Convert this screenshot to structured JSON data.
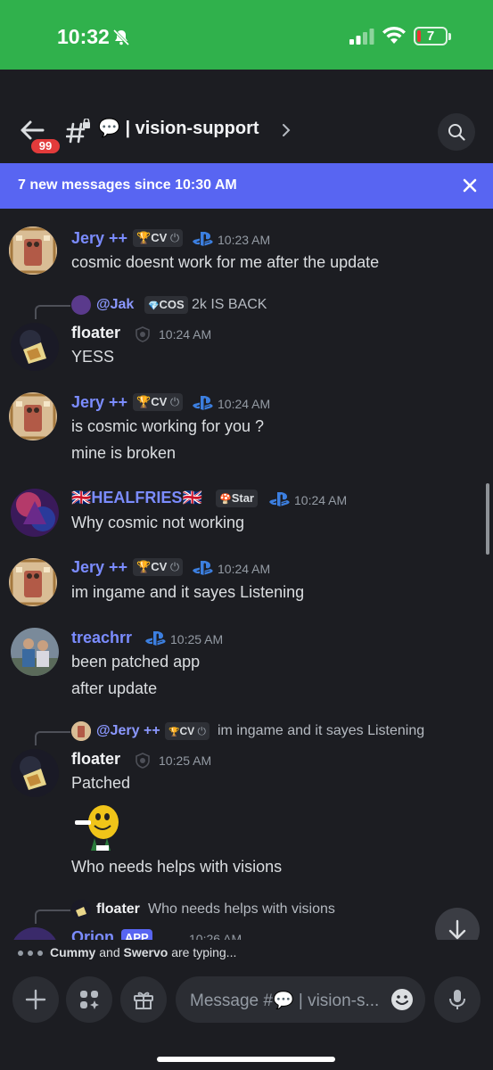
{
  "status_bar": {
    "time": "10:32",
    "battery": "7"
  },
  "header": {
    "notification_count": "99",
    "channel_name": "vision-support"
  },
  "banner": {
    "text": "7 new messages since 10:30 AM"
  },
  "messages": [
    {
      "user": "Jery ++",
      "tag": "CV",
      "time": "10:23 AM",
      "lines": [
        "cosmic doesnt work for me after the update"
      ]
    },
    {
      "reply_to_user": "@Jak",
      "reply_tag": "COS",
      "reply_text": "2k IS BACK",
      "user": "floater",
      "time": "10:24 AM",
      "lines": [
        "YESS"
      ]
    },
    {
      "user": "Jery ++",
      "tag": "CV",
      "time": "10:24 AM",
      "lines": [
        "is cosmic working for you ?",
        "mine is broken"
      ]
    },
    {
      "user": "HEALFRIES",
      "tag": "Star",
      "time": "10:24 AM",
      "lines": [
        "Why cosmic not working"
      ]
    },
    {
      "user": "Jery ++",
      "tag": "CV",
      "time": "10:24 AM",
      "lines": [
        "im ingame and it sayes Listening"
      ]
    },
    {
      "user": "treachrr",
      "time": "10:25 AM",
      "lines": [
        "been patched app",
        "after update"
      ]
    },
    {
      "reply_to_user": "@Jery ++",
      "reply_tag": "CV",
      "reply_text": "im ingame and it sayes Listening",
      "user": "floater",
      "time": "10:25 AM",
      "lines": [
        "Patched",
        "Who needs helps with visions"
      ]
    },
    {
      "reply_to_user": "floater",
      "reply_text": "Who needs helps with visions",
      "user": "Orion",
      "tag": "APP",
      "time": "10:26 AM"
    }
  ],
  "typing": {
    "user1": "Cummy",
    "user2": "Swervo",
    "suffix": "are typing...",
    "and": "and"
  },
  "composer": {
    "placeholder": "Message #💬 | vision-s..."
  },
  "colors": {
    "accent": "#5865f2",
    "status_bar": "#30b14c",
    "background": "#1c1d22",
    "username_blue": "#7b8cff"
  }
}
